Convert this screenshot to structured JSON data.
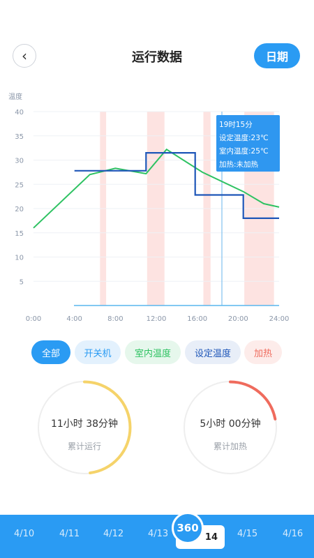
{
  "header": {
    "title": "运行数据",
    "back_icon": "‹",
    "date_button": "日期"
  },
  "chart_data": {
    "type": "line",
    "ylabel": "温度",
    "yticks": [
      "40",
      "35",
      "30",
      "25",
      "20",
      "15",
      "10",
      "5"
    ],
    "xticks": [
      "0:00",
      "4:00",
      "8:00",
      "12:00",
      "16:00",
      "20:00",
      "24:00"
    ],
    "xlim": [
      0,
      24
    ],
    "ylim": [
      0,
      40
    ],
    "heating_periods": [
      [
        6.5,
        7.1
      ],
      [
        11.1,
        12.8
      ],
      [
        16.6,
        17.3
      ],
      [
        20.6,
        23.5
      ]
    ],
    "series": [
      {
        "name": "室内温度",
        "color": "#2ec262",
        "points": [
          [
            0,
            16
          ],
          [
            5.5,
            27
          ],
          [
            8,
            28.3
          ],
          [
            11,
            27.2
          ],
          [
            13,
            32.2
          ],
          [
            16.5,
            27.5
          ],
          [
            20.5,
            23.5
          ],
          [
            22.5,
            21
          ],
          [
            24,
            20.3
          ]
        ]
      },
      {
        "name": "设定温度",
        "color": "#1e56b8",
        "points": [
          [
            4,
            27.8
          ],
          [
            11,
            27.8
          ],
          [
            11,
            31.5
          ],
          [
            15.8,
            31.5
          ],
          [
            15.8,
            22.8
          ],
          [
            20.5,
            22.8
          ],
          [
            20.5,
            18
          ],
          [
            24,
            18
          ]
        ]
      }
    ],
    "cursor_x": 19.25,
    "colors": {
      "heating": "#fde3e1",
      "cursor": "#67b6ee",
      "grid": "#eef1f5",
      "axis": "#59b6ee"
    }
  },
  "tooltip": {
    "time": "19时15分",
    "set_temp": "设定温度:23℃",
    "room_temp": "室内温度:25℃",
    "heating": "加热:未加热"
  },
  "filters": {
    "all": "全部",
    "power": "开关机",
    "room_temp": "室内温度",
    "set_temp": "设定温度",
    "heating": "加热"
  },
  "stats": {
    "runtime": {
      "value": "11小时 38分钟",
      "label": "累计运行",
      "color": "#f5d36a",
      "fraction": 0.48
    },
    "heating": {
      "value": "5小时 00分钟",
      "label": "累计加热",
      "color": "#ef6b5d",
      "fraction": 0.22
    }
  },
  "dates": [
    "4/10",
    "4/11",
    "4/12",
    "4/13",
    "14",
    "4/15",
    "4/16"
  ],
  "selected_date": "14",
  "logo_text": "360"
}
